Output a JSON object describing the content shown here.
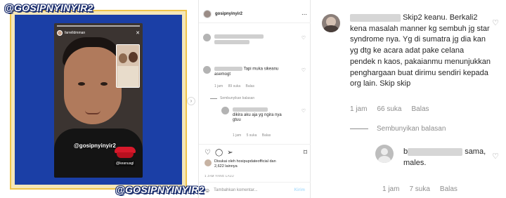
{
  "watermark": {
    "text": "@GOSIPNYINYIR2",
    "text_bottom": "@GOSIPNYINYIR2"
  },
  "story": {
    "username": "farrelldmman",
    "handle_overlay": "@gosipnyinyir2",
    "tag_overlay": "@keanuagl"
  },
  "post": {
    "username": "gosipnyinyir2",
    "comments": [
      {
        "id": "c1",
        "text": "",
        "likes": ""
      },
      {
        "id": "c2",
        "text_suffix": "Tapi muka sikeanu asemogt",
        "time": "1 jam",
        "likes": "89 suka",
        "reply": "Balas"
      }
    ],
    "hide_replies": "Sembunyikan balasan",
    "reply": {
      "text": "dikira aku aja yg ngira nya gtuu",
      "time": "1 jam",
      "likes": "5 suka",
      "reply_label": "Balas"
    },
    "liked_by": "Disukai oleh hosipupdateofficial dan",
    "liked_count": "2,622 lainnya",
    "time_ago": "1 JAM YANG LALU",
    "add_comment_placeholder": "Tambahkan komentar...",
    "send_label": "Kirim"
  },
  "zoom": {
    "comment1": {
      "lead": "Skip2 keanu. Berkali2 kena masalah manner kg sembuh jg star syndrome nya. Yg di sumatra jg dia kan yg dtg ke acara adat pake celana pendek n kaos, pakaianmu menunjukkan penghargaan buat dirimu sendiri kepada org lain. Skip skip",
      "time": "1 jam",
      "likes": "66 suka",
      "reply": "Balas"
    },
    "hide_replies": "Sembunyikan balasan",
    "comment2": {
      "initial": "b",
      "text_mid": "sama,",
      "text_end": "males.",
      "time": "1 jam",
      "likes": "7 suka",
      "reply": "Balas"
    }
  },
  "icons": [
    "more-icon",
    "heart-icon",
    "comment-icon",
    "share-icon",
    "bookmark-icon",
    "emoji-icon",
    "chevron-right-icon"
  ]
}
